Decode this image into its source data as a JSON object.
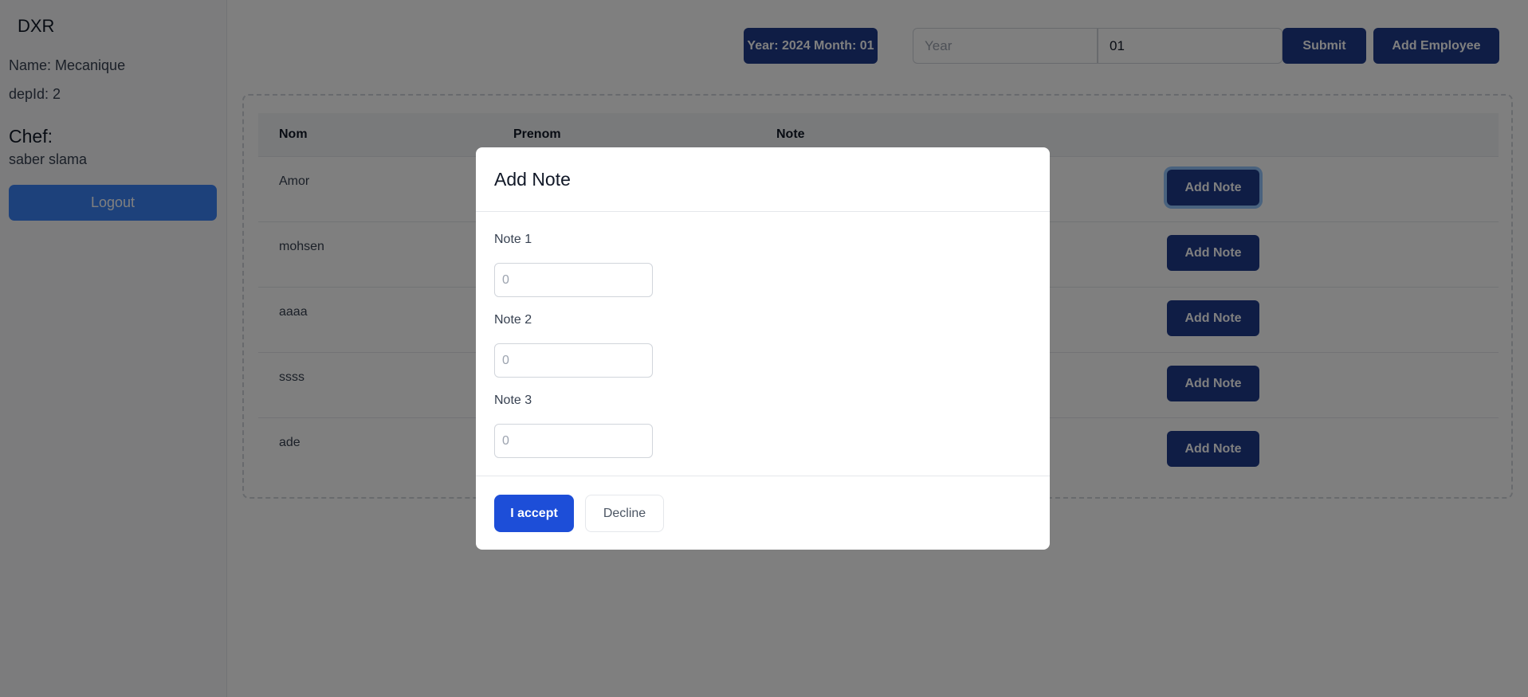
{
  "sidebar": {
    "brand": "DXR",
    "name": "Name: Mecanique",
    "dep": "depId: 2",
    "chef_heading": "Chef:",
    "chef_name": "saber slama",
    "logout_label": "Logout"
  },
  "toolbar": {
    "period_label": "Year: 2024 Month: 01",
    "year_placeholder": "Year",
    "month_value": "01",
    "submit_label": "Submit",
    "add_employee_label": "Add Employee"
  },
  "table": {
    "headers": {
      "nom": "Nom",
      "prenom": "Prenom",
      "note": "Note"
    },
    "rows": [
      {
        "nom": "Amor",
        "action": "Add Note"
      },
      {
        "nom": "mohsen",
        "action": "Add Note"
      },
      {
        "nom": "aaaa",
        "action": "Add Note"
      },
      {
        "nom": "ssss",
        "action": "Add Note"
      },
      {
        "nom": "ade",
        "action": "Add Note"
      }
    ]
  },
  "modal": {
    "title": "Add Note",
    "fields": [
      {
        "label": "Note 1",
        "placeholder": "0"
      },
      {
        "label": "Note 2",
        "placeholder": "0"
      },
      {
        "label": "Note 3",
        "placeholder": "0"
      }
    ],
    "accept_label": "I accept",
    "decline_label": "Decline"
  },
  "colors": {
    "primary_dark": "#1e3a8a",
    "logout_blue": "#3b82f6",
    "accept_blue": "#1d4ed8"
  }
}
